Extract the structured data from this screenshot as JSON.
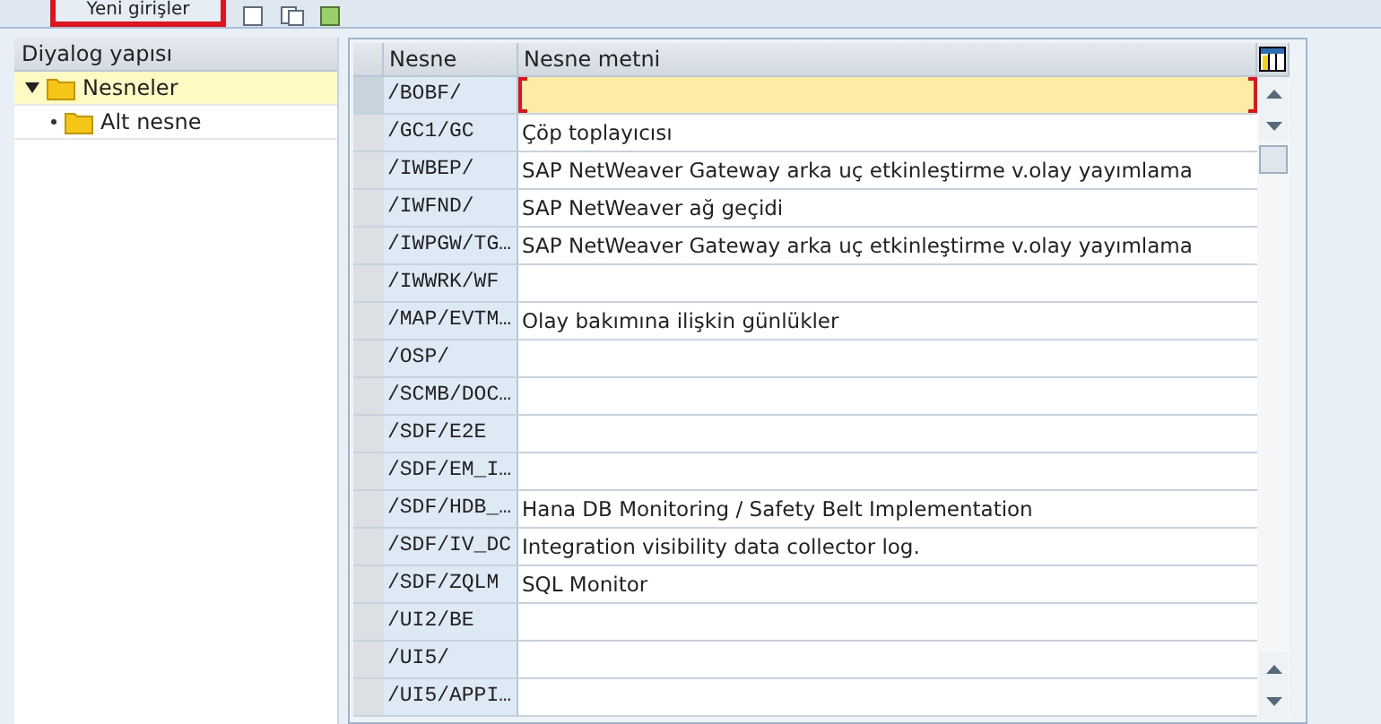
{
  "toolbar": {
    "button": "Yeni girişler"
  },
  "tree": {
    "title": "Diyalog yapısı",
    "items": [
      {
        "label": "Nesneler",
        "expanded": true,
        "selected": true,
        "children": [
          {
            "label": "Alt nesne",
            "selected": false
          }
        ]
      }
    ]
  },
  "table": {
    "columns": [
      "Nesne",
      "Nesne metni"
    ],
    "rows": [
      {
        "object": "/BOBF/",
        "text": "",
        "selected": true
      },
      {
        "object": "/GC1/GC",
        "text": "Çöp toplayıcısı",
        "selected": false
      },
      {
        "object": "/IWBEP/",
        "text": "SAP NetWeaver Gateway arka uç etkinleştirme v.olay yayımlama",
        "selected": false
      },
      {
        "object": "/IWFND/",
        "text": "SAP NetWeaver ağ geçidi",
        "selected": false
      },
      {
        "object": "/IWPGW/TG…",
        "text": "SAP NetWeaver Gateway arka uç etkinleştirme v.olay yayımlama",
        "selected": false
      },
      {
        "object": "/IWWRK/WF",
        "text": "",
        "selected": false
      },
      {
        "object": "/MAP/EVTM…",
        "text": "Olay bakımına ilişkin günlükler",
        "selected": false
      },
      {
        "object": "/OSP/",
        "text": "",
        "selected": false
      },
      {
        "object": "/SCMB/DOC…",
        "text": "",
        "selected": false
      },
      {
        "object": "/SDF/E2E",
        "text": "",
        "selected": false
      },
      {
        "object": "/SDF/EM_I…",
        "text": "",
        "selected": false
      },
      {
        "object": "/SDF/HDB_…",
        "text": "Hana DB Monitoring / Safety Belt Implementation",
        "selected": false
      },
      {
        "object": "/SDF/IV_DC",
        "text": "Integration visibility data collector log.",
        "selected": false
      },
      {
        "object": "/SDF/ZQLM",
        "text": "SQL Monitor",
        "selected": false
      },
      {
        "object": "/UI2/BE",
        "text": "",
        "selected": false
      },
      {
        "object": "/UI5/",
        "text": "",
        "selected": false
      },
      {
        "object": "/UI5/APPI…",
        "text": "",
        "selected": false
      }
    ]
  }
}
